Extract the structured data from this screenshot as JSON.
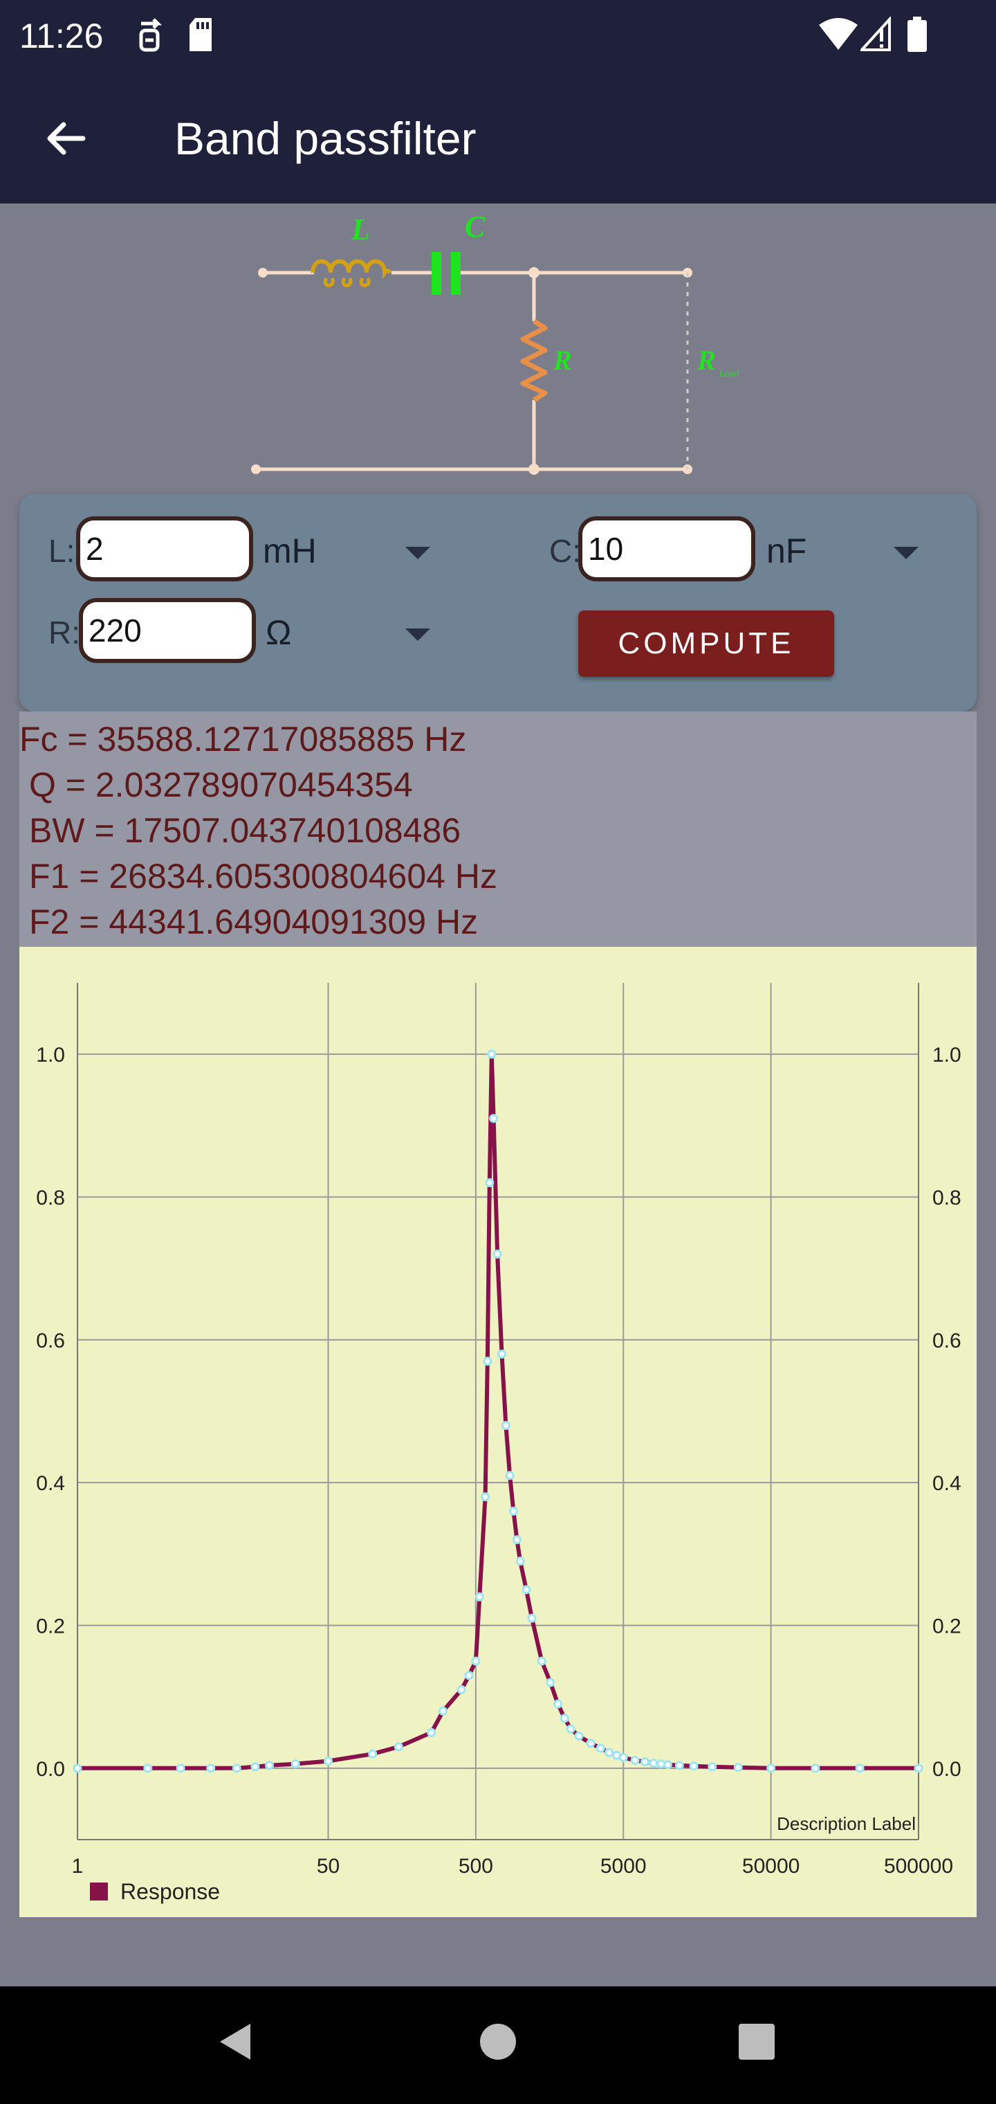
{
  "status_bar": {
    "time": "11:26",
    "icons": [
      "sync-icon",
      "sd-card-icon",
      "wifi-icon",
      "signal-icon",
      "battery-icon"
    ]
  },
  "app_bar": {
    "title": "Band passfilter",
    "back_icon": "arrow-back-icon"
  },
  "circuit": {
    "labels": {
      "inductor": "L",
      "capacitor": "C",
      "resistor": "R",
      "load": "R",
      "load_sub": "Load"
    },
    "colors": {
      "wire": "#f7dcc8",
      "inductor": "#d4a017",
      "capacitor": "#1ee31e",
      "resistor": "#e8904a",
      "label_green": "#1ee31e"
    }
  },
  "inputs": {
    "l": {
      "label": "L:",
      "value": "2",
      "unit": "mH"
    },
    "c": {
      "label": "C:",
      "value": "10",
      "unit": "nF"
    },
    "r": {
      "label": "R:",
      "value": "220",
      "unit": "Ω"
    },
    "compute_label": "COMPUTE"
  },
  "results": {
    "fc": "Fc = 35588.12717085885 Hz",
    "q": "Q = 2.032789070454354",
    "bw": "BW = 17507.043740108486",
    "f1": "F1 = 26834.605300804604 Hz",
    "f2": "F2 = 44341.64904091309 Hz"
  },
  "chart_data": {
    "type": "line",
    "x_scale": "log",
    "x_tick_labels": [
      "1",
      "50",
      "500",
      "5000",
      "50000",
      "500000"
    ],
    "y_ticks": [
      0.0,
      0.2,
      0.4,
      0.6,
      0.8,
      1.0
    ],
    "y_tick_labels": [
      "0.0",
      "0.2",
      "0.4",
      "0.6",
      "0.8",
      "1.0"
    ],
    "ylim": [
      -0.1,
      1.1
    ],
    "description_label": "Description Label",
    "legend_position": "bottom-left",
    "series": [
      {
        "name": "Response",
        "color": "#86124a",
        "marker_color": "#9ee4f5",
        "x": [
          1,
          3,
          5,
          8,
          12,
          16,
          20,
          30,
          50,
          100,
          150,
          250,
          300,
          400,
          450,
          500,
          530,
          580,
          600,
          620,
          640,
          660,
          700,
          750,
          800,
          850,
          900,
          950,
          1000,
          1100,
          1200,
          1400,
          1600,
          1800,
          2000,
          2200,
          2500,
          3000,
          3500,
          4000,
          4500,
          5000,
          6000,
          7000,
          8000,
          9000,
          10000,
          12000,
          15000,
          20000,
          30000,
          50000,
          100000,
          200000,
          500000
        ],
        "values": [
          0.0,
          0.0,
          0.0,
          0.0,
          0.0,
          0.002,
          0.004,
          0.006,
          0.01,
          0.02,
          0.03,
          0.05,
          0.08,
          0.11,
          0.13,
          0.15,
          0.24,
          0.38,
          0.57,
          0.82,
          1.0,
          0.91,
          0.72,
          0.58,
          0.48,
          0.41,
          0.36,
          0.32,
          0.29,
          0.25,
          0.21,
          0.15,
          0.12,
          0.09,
          0.07,
          0.055,
          0.045,
          0.035,
          0.028,
          0.022,
          0.018,
          0.015,
          0.011,
          0.009,
          0.007,
          0.006,
          0.005,
          0.004,
          0.003,
          0.002,
          0.001,
          0.0,
          0.0,
          0.0,
          0.0
        ]
      }
    ]
  },
  "nav_bar": {
    "icons": [
      "back-triangle-icon",
      "home-circle-icon",
      "recents-square-icon"
    ]
  }
}
